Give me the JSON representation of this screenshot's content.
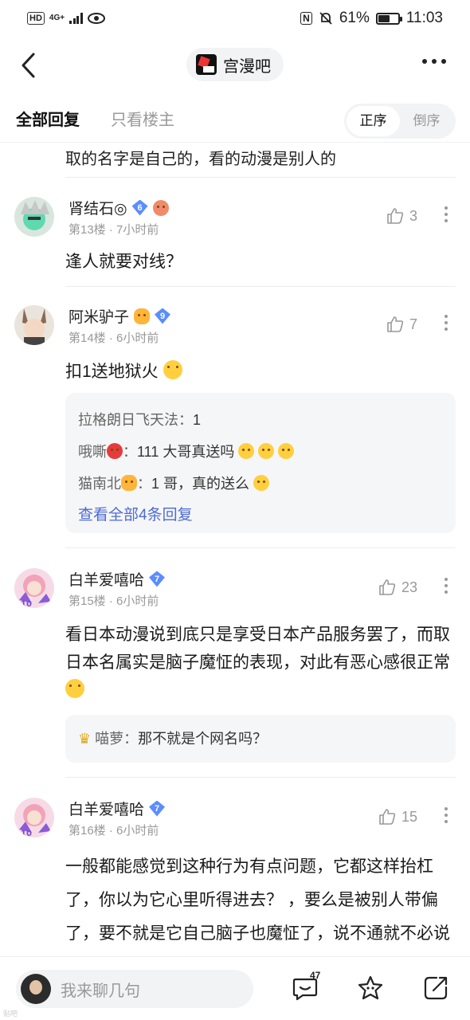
{
  "status_bar": {
    "hd": "HD",
    "network": "4G+",
    "nfc": "N",
    "battery_pct": "61%",
    "battery_level": 0.61,
    "time": "11:03"
  },
  "nav": {
    "forum_name": "宫漫吧"
  },
  "tabs": {
    "all": "全部回复",
    "owner_only": "只看楼主",
    "order_asc": "正序",
    "order_desc": "倒序"
  },
  "cutoff_text": "取的名字是自己的，看的动漫是别人的",
  "replies": [
    {
      "username": "肾结石◎",
      "level": "6",
      "floor": "第13楼",
      "time": "7小时前",
      "likes": "3",
      "content": "逢人就要对线？"
    },
    {
      "username": "阿米驴子",
      "level": "9",
      "floor": "第14楼",
      "time": "6小时前",
      "likes": "7",
      "content": "扣1送地狱火",
      "sub_replies": [
        {
          "name": "拉格朗日飞天法：",
          "text": "1"
        },
        {
          "name": "哦嘶",
          "sep": "：",
          "text": "111 大哥真送吗"
        },
        {
          "name": "猫南北",
          "sep": "：",
          "text": "1 哥，真的送么"
        }
      ],
      "view_all": "查看全部4条回复"
    },
    {
      "username": "白羊爱嘻哈",
      "level": "7",
      "floor": "第15楼",
      "time": "6小时前",
      "likes": "23",
      "content": "看日本动漫说到底只是享受日本产品服务罢了，而取日本名属实是脑子魔怔的表现，对此有恶心感很正常",
      "sub_replies": [
        {
          "name": "喵萝：",
          "text": "那不就是个网名吗？"
        }
      ]
    },
    {
      "username": "白羊爱嘻哈",
      "level": "7",
      "floor": "第16楼",
      "time": "6小时前",
      "likes": "15",
      "content": "一般都能感觉到这种行为有点问题，它都这样抬杠了，你以为它心里听得进去？ ，要么是被别人带偏了，要不就是它自己脑子也魔怔了，说不通就不必说 《你说的都对 》"
    }
  ],
  "bottom_bar": {
    "input_placeholder": "我来聊几句",
    "comment_count": "47"
  },
  "watermark": "贴吧"
}
